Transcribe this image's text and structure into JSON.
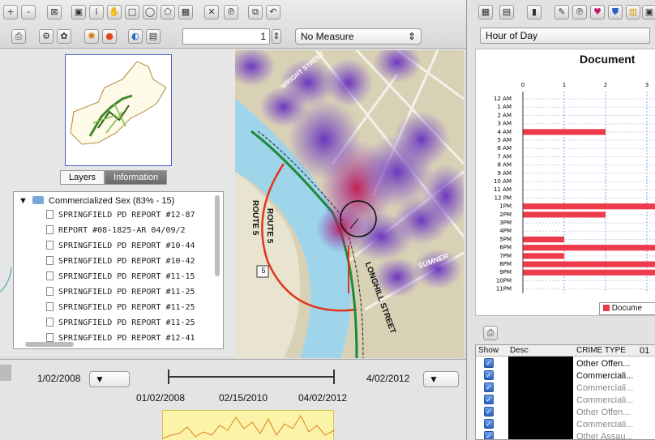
{
  "toolbar": {
    "number_value": "1",
    "measure_select": "No Measure"
  },
  "left_panel": {
    "tabs": [
      "Layers",
      "Information"
    ],
    "tree_root": "Commercialized Sex (83% - 15)",
    "reports": [
      "SPRINGFIELD PD REPORT #12-87",
      "REPORT #08-1825-AR 04/09/2",
      "SPRINGFIELD PD REPORT #10-44",
      "SPRINGFIELD PD REPORT #10-42",
      "SPRINGFIELD PD REPORT #11-15",
      "SPRINGFIELD PD REPORT #11-25",
      "SPRINGFIELD PD REPORT #11-25",
      "SPRINGFIELD PD REPORT #11-25",
      "SPRINGFIELD PD REPORT #12-41"
    ]
  },
  "map": {
    "labels": [
      "ROUTE 5",
      "ROUTE 5",
      "LONGHILL STREET",
      "WRIGHT STREET",
      "SUMNER",
      "5"
    ]
  },
  "timeline": {
    "start_date": "1/02/2008",
    "end_date": "4/02/2012",
    "ticks": [
      "01/02/2008",
      "02/15/2010",
      "04/02/2012"
    ]
  },
  "right_panel": {
    "group_select": "Hour of Day",
    "chart_title": "Document",
    "legend": "Docume",
    "table_headers": [
      "Show",
      "Desc",
      "CRIME TYPE",
      "01"
    ],
    "table_rows": [
      {
        "type": "Other Offen...",
        "dim": false
      },
      {
        "type": "Commerciali...",
        "dim": false
      },
      {
        "type": "Commerciali...",
        "dim": true
      },
      {
        "type": "Commerciali...",
        "dim": true
      },
      {
        "type": "Other Offen...",
        "dim": true
      },
      {
        "type": "Commerciali...",
        "dim": true
      },
      {
        "type": "Other Assau...",
        "dim": true
      }
    ],
    "bar_color": "#ee3b4b"
  },
  "chart_data": {
    "type": "bar",
    "title": "Document",
    "orientation": "horizontal",
    "x_ticks": [
      "0",
      "1",
      "2",
      "3",
      "4"
    ],
    "xlim": [
      0,
      4
    ],
    "categories": [
      "12 AM",
      "1 AM",
      "2 AM",
      "3 AM",
      "4 AM",
      "5 AM",
      "6 AM",
      "7 AM",
      "8 AM",
      "9 AM",
      "10 AM",
      "11 AM",
      "12 PM",
      "1PM",
      "2PM",
      "3PM",
      "4PM",
      "5PM",
      "6PM",
      "7PM",
      "8PM",
      "9PM",
      "10PM",
      "11PM"
    ],
    "values": [
      0,
      0,
      0,
      0,
      2,
      0,
      0,
      0,
      0,
      0,
      0,
      0,
      0,
      4,
      2,
      0,
      0,
      1,
      4,
      1,
      4,
      4,
      0,
      0
    ],
    "legend": "Docume",
    "grid": true
  }
}
